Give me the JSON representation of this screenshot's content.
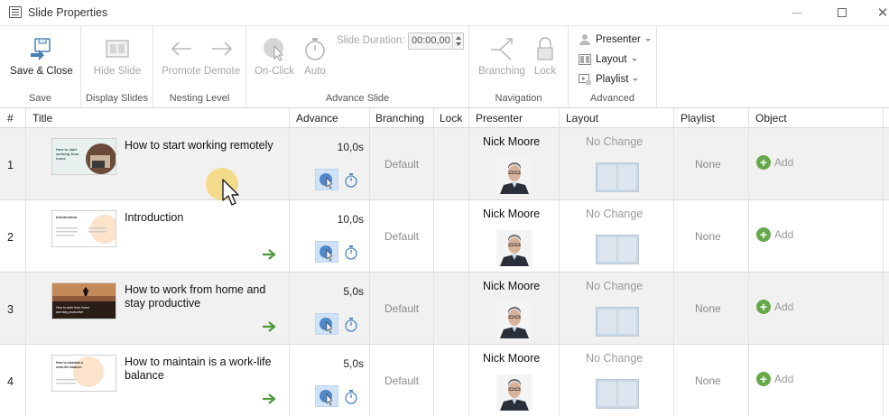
{
  "window": {
    "title": "Slide Properties",
    "minimize_icon": "minimize-icon",
    "maximize_icon": "maximize-icon",
    "close_icon": "close-icon"
  },
  "ribbon": {
    "save": {
      "group_label": "Save",
      "save_close_label": "Save & Close"
    },
    "display": {
      "group_label": "Display Slides",
      "hide_label": "Hide Slide"
    },
    "nesting": {
      "group_label": "Nesting Level",
      "promote_label": "Promote",
      "demote_label": "Demote"
    },
    "advance": {
      "group_label": "Advance Slide",
      "onclick_label": "On-Click",
      "auto_label": "Auto",
      "duration_label": "Slide Duration:",
      "duration_value": "00:00,00"
    },
    "navigation": {
      "group_label": "Navigation",
      "branching_label": "Branching",
      "lock_label": "Lock"
    },
    "advanced": {
      "group_label": "Advanced",
      "presenter_label": "Presenter",
      "layout_label": "Layout",
      "playlist_label": "Playlist"
    }
  },
  "table": {
    "columns": {
      "num": "#",
      "title": "Title",
      "advance": "Advance",
      "branching": "Branching",
      "lock": "Lock",
      "presenter": "Presenter",
      "layout": "Layout",
      "playlist": "Playlist",
      "object": "Object"
    },
    "rows": [
      {
        "num": "1",
        "title": "How to start working remotely",
        "thumb_text": "How to start working from home",
        "duration": "10,0s",
        "branching": "Default",
        "presenter": "Nick Moore",
        "layout": "No Change",
        "playlist": "None",
        "object": "Add"
      },
      {
        "num": "2",
        "title": "Introduction",
        "thumb_text": "Introduction",
        "duration": "10,0s",
        "branching": "Default",
        "presenter": "Nick Moore",
        "layout": "No Change",
        "playlist": "None",
        "object": "Add"
      },
      {
        "num": "3",
        "title": "How to work from home and stay productive",
        "thumb_text": "How to work from home and stay productive",
        "duration": "5,0s",
        "branching": "Default",
        "presenter": "Nick Moore",
        "layout": "No Change",
        "playlist": "None",
        "object": "Add"
      },
      {
        "num": "4",
        "title": "How to maintain is a work-life balance",
        "thumb_text": "How to maintain a work-life balance",
        "duration": "5,0s",
        "branching": "Default",
        "presenter": "Nick Moore",
        "layout": "No Change",
        "playlist": "None",
        "object": "Add"
      }
    ]
  },
  "colors": {
    "accent_blue": "#5b9bd5",
    "onclick_bg": "#cfe2f6",
    "add_green": "#67a84a",
    "next_arrow_green": "#4e9a3a",
    "row_shade": "#f1f1f1",
    "cursor_halo": "#f5d25f"
  }
}
